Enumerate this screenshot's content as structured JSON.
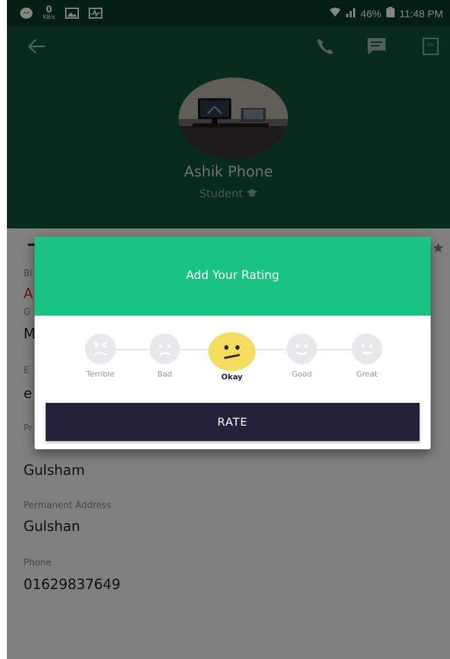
{
  "status_bar": {
    "network_speed_value": "0",
    "network_speed_unit": "KB/s",
    "battery": "46%",
    "time": "11:48 PM"
  },
  "profile": {
    "name": "Ashik Phone",
    "role": "Student",
    "cv_label": "cv"
  },
  "fields": [
    {
      "label": "Present Address",
      "value": "Gulsham"
    },
    {
      "label": "Permanent Address",
      "value": "Gulshan"
    },
    {
      "label": "Phone",
      "value": "01629837649"
    }
  ],
  "partial_fields": {
    "label_1": "Bl",
    "value_1": "A",
    "label_2": "G",
    "value_2": "M",
    "label_3": "E",
    "value_3": "e",
    "label_4": "Pr"
  },
  "dialog": {
    "title": "Add Your Rating",
    "options": [
      "Terrible",
      "Bad",
      "Okay",
      "Good",
      "Great"
    ],
    "selected": "Okay",
    "button_label": "RATE"
  },
  "colors": {
    "header": "#0f5337",
    "status_bar": "#0a3d25",
    "dialog_accent": "#18c383",
    "button": "#26213a",
    "selected_face": "#f4dd5e"
  }
}
